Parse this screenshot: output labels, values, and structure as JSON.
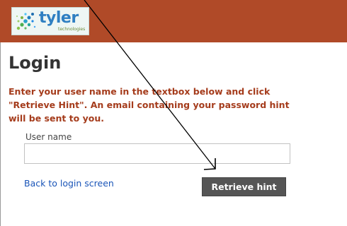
{
  "header": {
    "logo_text": "tyler",
    "logo_subtext": "technologies",
    "background_color": "#b04a28"
  },
  "main": {
    "title": "Login",
    "instructions": "Enter your user name in the textbox below and click \"Retrieve Hint\". An email containing your password hint will be sent to you.",
    "username_label": "User name",
    "username_value": "",
    "back_link_label": "Back to login screen",
    "retrieve_button_label": "Retrieve hint"
  },
  "colors": {
    "accent": "#b04a28",
    "instruction_text": "#a53c1c",
    "link": "#1a55b8",
    "button_bg": "#555555"
  }
}
